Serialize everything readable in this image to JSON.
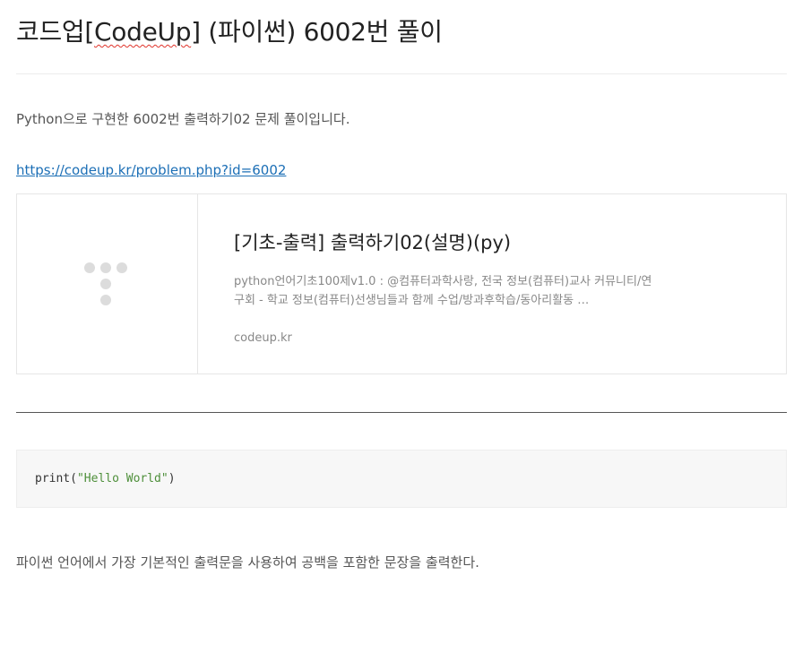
{
  "post": {
    "title_prefix": "코드업[",
    "title_highlight": "CodeUp",
    "title_suffix": "] (파이썬) 6002번 풀이",
    "intro": "Python으로 구현한 6002번 출력하기02 문제 풀이입니다.",
    "link_text": "https://codeup.kr/problem.php?id=6002",
    "outro": "파이썬 언어에서 가장 기본적인 출력문을 사용하여 공백을 포함한 문장을 출력한다."
  },
  "card": {
    "title": "[기초-출력] 출력하기02(설명)(py)",
    "description": "python언어기초100제v1.0 : @컴퓨터과학사랑, 전국 정보(컴퓨터)교사 커뮤니티/연구회 - 학교 정보(컴퓨터)선생님들과 함께 수업/방과후학습/동아리활동 …",
    "domain": "codeup.kr",
    "logo_icon": "codeup-dots-logo-icon"
  },
  "code": {
    "func": "print(",
    "string": "\"Hello World\"",
    "close": ")"
  },
  "colors": {
    "link": "#1c6fb6",
    "code_string": "#4e8f3a",
    "code_background": "#f7f7f7",
    "spellcheck_underline": "#e0342b"
  }
}
